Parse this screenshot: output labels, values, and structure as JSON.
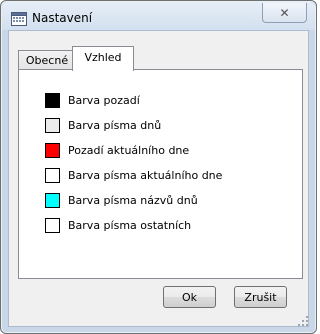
{
  "window": {
    "title": "Nastavení",
    "close_symbol": "✕"
  },
  "icons": {
    "app": "calendar-icon",
    "close": "close-icon",
    "resize": "resize-grip-icon"
  },
  "tabs": [
    {
      "label": "Obecné",
      "selected": false
    },
    {
      "label": "Vzhled",
      "selected": true
    }
  ],
  "colors": [
    {
      "label": "Barva pozadí",
      "color": "#000000"
    },
    {
      "label": "Barva písma dnů",
      "color": "#ebebeb"
    },
    {
      "label": "Pozadí aktuálního dne",
      "color": "#ff0000"
    },
    {
      "label": "Barva písma aktuálního dne",
      "color": "#ffffff"
    },
    {
      "label": "Barva písma názvů dnů",
      "color": "#00ffff"
    },
    {
      "label": "Barva písma ostatních",
      "color": "#ffffff"
    }
  ],
  "buttons": {
    "ok": "Ok",
    "cancel": "Zrušit"
  }
}
